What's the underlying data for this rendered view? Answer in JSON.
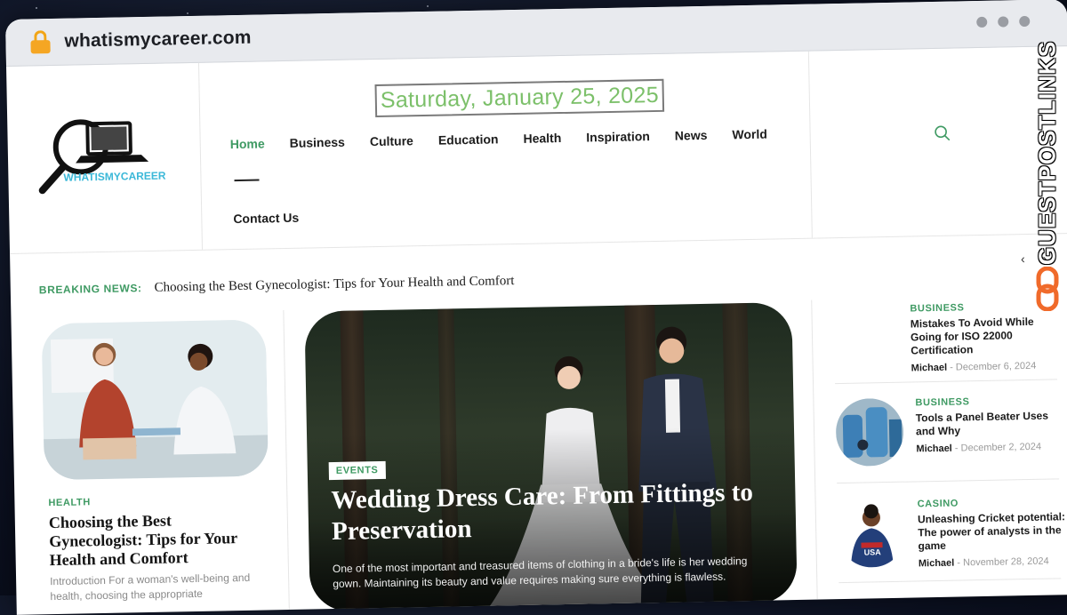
{
  "browser": {
    "url": "whatismycareer.com"
  },
  "site": {
    "logo_text": "WHATISMYCAREER",
    "date": "Saturday, January 25, 2025"
  },
  "nav": {
    "items": [
      "Home",
      "Business",
      "Culture",
      "Education",
      "Health",
      "Inspiration",
      "News",
      "World"
    ],
    "active": "Home",
    "contact": "Contact Us"
  },
  "breaking": {
    "label": "BREAKING NEWS:",
    "headline": "Choosing the Best Gynecologist: Tips for Your Health and Comfort"
  },
  "left_post": {
    "category": "HEALTH",
    "title": "Choosing the Best Gynecologist: Tips for Your Health and Comfort",
    "excerpt": "Introduction For a woman's well-being and health, choosing the appropriate"
  },
  "hero": {
    "category": "EVENTS",
    "title": "Wedding Dress Care: From Fittings to Preservation",
    "excerpt": "One of the most important and treasured items of clothing in a bride's life is her wedding gown. Maintaining its beauty and value requires making sure everything is flawless."
  },
  "side_posts": [
    {
      "category": "BUSINESS",
      "title": "Mistakes To Avoid While Going for ISO 22000 Certification",
      "author": "Michael",
      "date": "December 6, 2024"
    },
    {
      "category": "BUSINESS",
      "title": "Tools a Panel Beater Uses and Why",
      "author": "Michael",
      "date": "December 2, 2024"
    },
    {
      "category": "CASINO",
      "title": "Unleashing Cricket potential: The power of analysts in the game",
      "author": "Michael",
      "date": "November 28, 2024"
    }
  ],
  "watermark": "GUESTPOSTLINKS",
  "colors": {
    "accent": "#3f9a63",
    "date": "#7cc06a",
    "logo": "#3bb8d8"
  }
}
